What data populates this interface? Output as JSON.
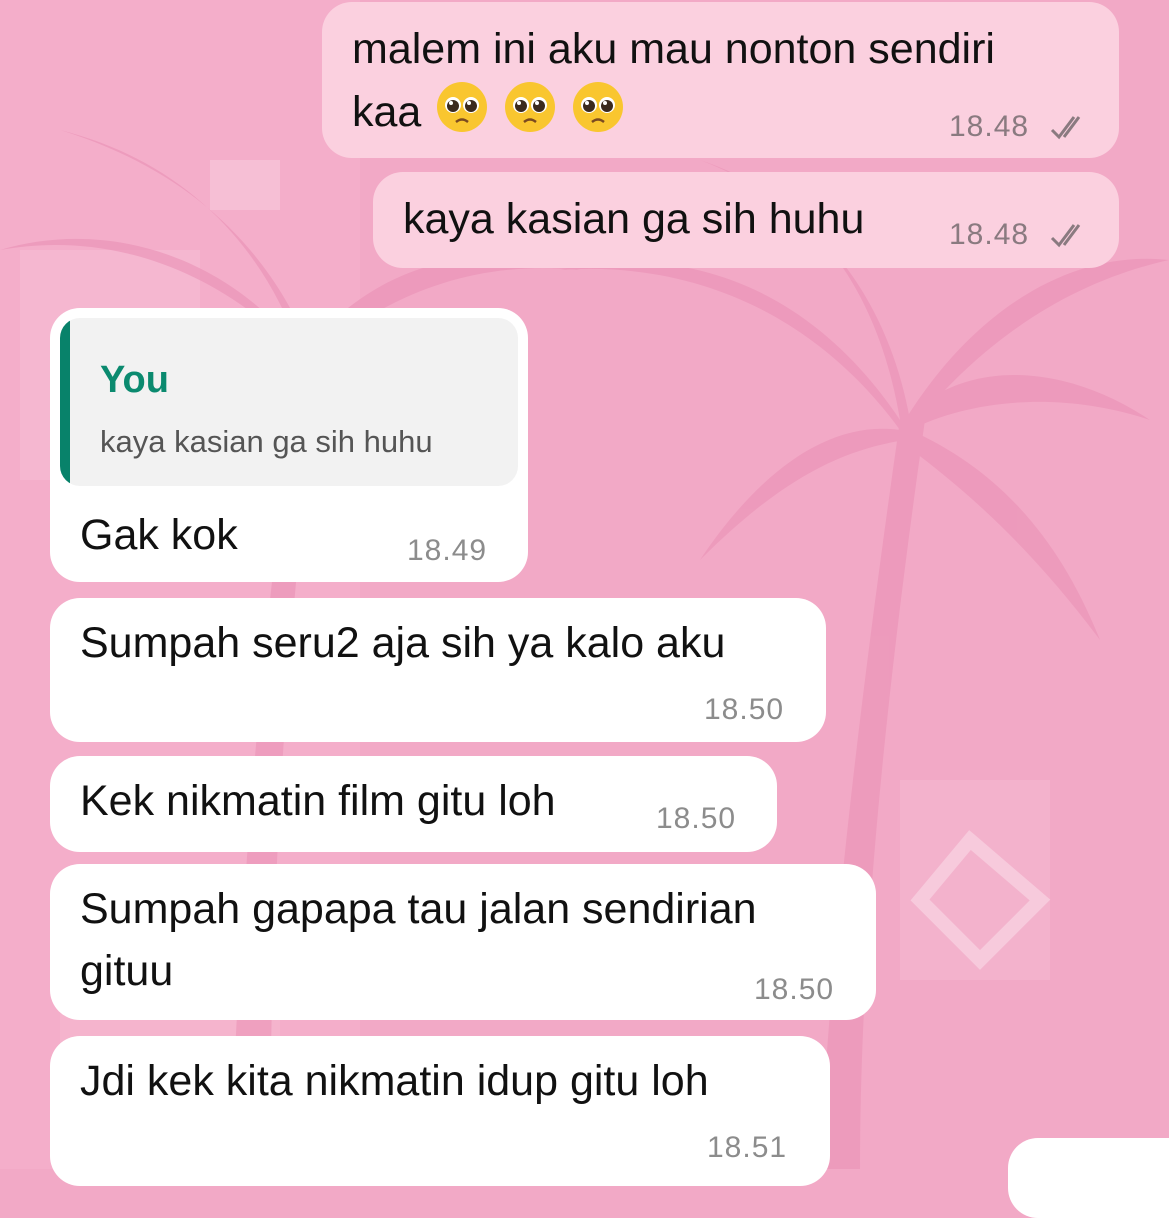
{
  "theme": {
    "background": "#f2a9c6",
    "outgoing_bubble": "#fbd0df",
    "incoming_bubble": "#ffffff",
    "quote_accent": "#08826a",
    "tick_color": "#8a7a80"
  },
  "messages": [
    {
      "direction": "outgoing",
      "text_line1": "malem ini aku mau nonton sendiri",
      "text_line2": "kaa",
      "emojis": [
        "pleading-face-emoji",
        "pleading-face-emoji",
        "pleading-face-emoji"
      ],
      "time": "18.48",
      "status": "read-double-check"
    },
    {
      "direction": "outgoing",
      "text": "kaya kasian ga sih huhu",
      "time": "18.48",
      "status": "read-double-check"
    },
    {
      "direction": "incoming",
      "reply_to": {
        "author": "You",
        "text": "kaya kasian ga sih huhu"
      },
      "text": "Gak kok",
      "time": "18.49"
    },
    {
      "direction": "incoming",
      "text": "Sumpah seru2 aja sih ya kalo aku",
      "time": "18.50"
    },
    {
      "direction": "incoming",
      "text": "Kek nikmatin film gitu loh",
      "time": "18.50"
    },
    {
      "direction": "incoming",
      "text_line1": "Sumpah gapapa tau jalan sendirian",
      "text_line2": "gituu",
      "time": "18.50"
    },
    {
      "direction": "incoming",
      "text": "Jdi kek kita nikmatin idup gitu loh",
      "time": "18.51"
    }
  ]
}
